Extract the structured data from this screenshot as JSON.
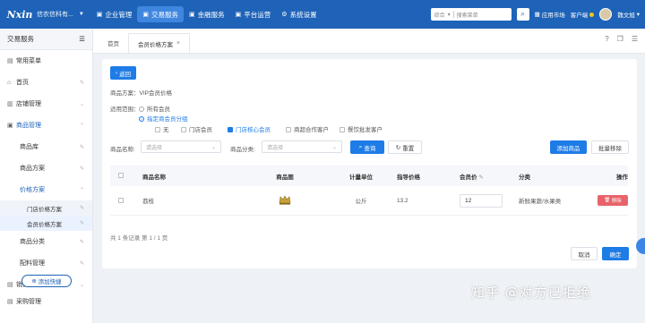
{
  "topbar": {
    "logo": "Nxin",
    "org": "信农信科有...",
    "nav": [
      {
        "label": "企业管理",
        "icon": "building-icon"
      },
      {
        "label": "交易服务",
        "icon": "cart-icon"
      },
      {
        "label": "金融服务",
        "icon": "finance-icon"
      },
      {
        "label": "平台运营",
        "icon": "platform-icon"
      },
      {
        "label": "系统设置",
        "icon": "gear-icon"
      }
    ],
    "search_scope": "综合",
    "search_placeholder": "搜索菜单",
    "app_market": "应用市场",
    "customer_service": "客户端",
    "user_name": "魏文旭"
  },
  "sidebar": {
    "header": "交易服务",
    "items": [
      {
        "label": "常用菜单",
        "icon": "menu-icon"
      },
      {
        "label": "首页",
        "icon": "home-icon"
      },
      {
        "label": "店铺管理",
        "icon": "shop-icon"
      },
      {
        "label": "商品管理",
        "icon": "goods-icon"
      },
      {
        "label": "商品库"
      },
      {
        "label": "商品方案"
      },
      {
        "label": "价格方案"
      },
      {
        "label": "门店价格方案"
      },
      {
        "label": "会员价格方案"
      },
      {
        "label": "商品分类"
      },
      {
        "label": "配料管理"
      },
      {
        "label": "销售管理",
        "icon": "sales-icon"
      },
      {
        "label": "采购管理",
        "icon": "purchase-icon"
      }
    ],
    "add_shortcut": "添加快捷"
  },
  "tabs": [
    {
      "label": "首页"
    },
    {
      "label": "会员价格方案"
    }
  ],
  "form": {
    "back_label": "返回",
    "plan_label": "商品方案：",
    "plan_value": "VIP会员价格",
    "scope_label": "适用范围：",
    "scope_all": "所有会员",
    "scope_group": "指定商会员分组",
    "groups": [
      {
        "label": "无",
        "checked": false
      },
      {
        "label": "门店会员",
        "checked": false
      },
      {
        "label": "门店核心会员",
        "checked": true
      },
      {
        "label": "商超合作客户",
        "checked": false
      },
      {
        "label": "餐饮批发客户",
        "checked": false
      }
    ],
    "name_filter_label": "商品名称:",
    "name_filter_placeholder": "请选择",
    "category_filter_label": "商品分类:",
    "category_filter_placeholder": "请选择",
    "query_label": "查询",
    "reset_label": "重置",
    "add_goods_label": "添加商品",
    "batch_remove_label": "批量移除"
  },
  "table": {
    "headers": [
      "商品名称",
      "商品图",
      "计量单位",
      "指导价格",
      "会员价",
      "分类",
      "操作"
    ],
    "rows": [
      {
        "name": "荔枝",
        "unit": "公斤",
        "guide_price": "13.2",
        "member_price": "12",
        "category": "新鲜果蔬/水果类",
        "action": "移除"
      }
    ],
    "footer": "共 1 条记录 第 1 / 1 页"
  },
  "actions": {
    "cancel": "取消",
    "confirm": "确定"
  },
  "watermark": "知乎 @对方已拒绝",
  "colors": {
    "brand": "#1e63b8",
    "primary": "#1e7ce6",
    "danger": "#e8646a"
  }
}
